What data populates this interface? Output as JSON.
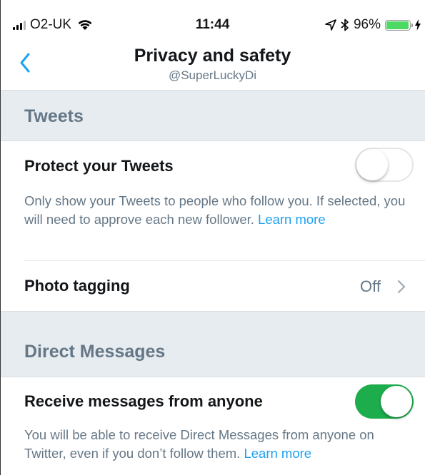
{
  "status_bar": {
    "carrier": "O2-UK",
    "time": "11:44",
    "battery": "96%",
    "battery_level": 0.96
  },
  "nav": {
    "title": "Privacy and safety",
    "subtitle": "@SuperLuckyDi"
  },
  "sections": {
    "tweets": {
      "header": "Tweets",
      "protect": {
        "title": "Protect your Tweets",
        "description": "Only show your Tweets to people who follow you. If selected, you will need to approve each new follower.",
        "link": "Learn more",
        "enabled": false
      },
      "photo_tagging": {
        "title": "Photo tagging",
        "value": "Off"
      }
    },
    "dms": {
      "header": "Direct Messages",
      "receive": {
        "title": "Receive messages from anyone",
        "description": "You will be able to receive Direct Messages from anyone on Twitter, even if you don’t follow them.",
        "link": "Learn more",
        "enabled": true
      }
    }
  },
  "colors": {
    "accent": "#1da1f2",
    "toggle_on": "#1dad4d",
    "section_bg": "#e6ecf0"
  }
}
